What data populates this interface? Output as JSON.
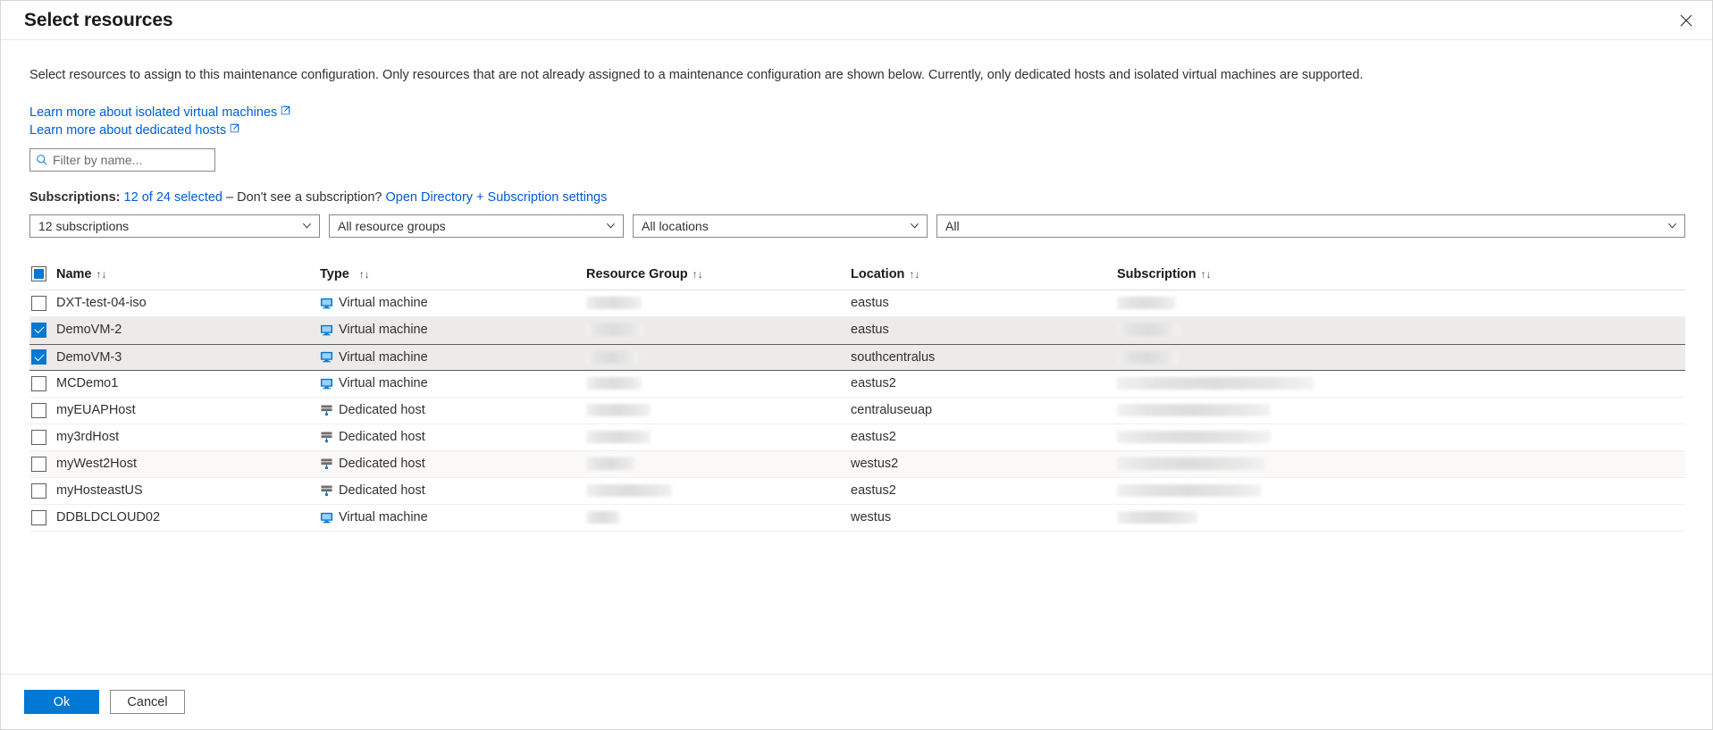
{
  "header": {
    "title": "Select resources",
    "close_label": "✕"
  },
  "description": "Select resources to assign to this maintenance configuration. Only resources that are not already assigned to a maintenance configuration are shown below. Currently, only dedicated hosts and isolated virtual machines are supported.",
  "links": [
    {
      "label": "Learn more about isolated virtual machines"
    },
    {
      "label": "Learn more about dedicated hosts"
    }
  ],
  "filter": {
    "placeholder": "Filter by name...",
    "value": ""
  },
  "subscriptions_line": {
    "label": "Subscriptions:",
    "selected_link": "12 of 24 selected",
    "separator": "– Don't see a subscription?",
    "settings_link": "Open Directory + Subscription settings"
  },
  "dropdowns": [
    {
      "name": "subscription-filter",
      "value": "12 subscriptions"
    },
    {
      "name": "resource-group-filter",
      "value": "All resource groups"
    },
    {
      "name": "location-filter",
      "value": "All locations"
    },
    {
      "name": "type-filter",
      "value": "All"
    }
  ],
  "table": {
    "columns": [
      {
        "key": "name",
        "label": "Name",
        "sort": "↑↓"
      },
      {
        "key": "type",
        "label": "Type",
        "sort": "↑↓"
      },
      {
        "key": "resource_group",
        "label": "Resource Group",
        "sort": "↑↓"
      },
      {
        "key": "location",
        "label": "Location",
        "sort": "↑↓"
      },
      {
        "key": "subscription",
        "label": "Subscription",
        "sort": "↑↓"
      }
    ],
    "header_checkbox_state": "indeterminate",
    "rows": [
      {
        "name": "DXT-test-04-iso",
        "type": "Virtual machine",
        "type_icon": "virtual-machine-icon",
        "resource_group": "",
        "rg_width": 62,
        "location": "eastus",
        "subscription": "",
        "sub_width": 66,
        "checked": false,
        "state": "default"
      },
      {
        "name": "DemoVM-2",
        "type": "Virtual machine",
        "type_icon": "virtual-machine-icon",
        "resource_group": "",
        "rg_width": 64,
        "location": "eastus",
        "subscription": "",
        "sub_width": 70,
        "checked": true,
        "state": "selected"
      },
      {
        "name": "DemoVM-3",
        "type": "Virtual machine",
        "type_icon": "virtual-machine-icon",
        "resource_group": "",
        "rg_width": 58,
        "location": "southcentralus",
        "subscription": "",
        "sub_width": 68,
        "checked": true,
        "state": "focused"
      },
      {
        "name": "MCDemo1",
        "type": "Virtual machine",
        "type_icon": "virtual-machine-icon",
        "resource_group": "",
        "rg_width": 62,
        "location": "eastus2",
        "subscription": "",
        "sub_width": 220,
        "checked": false,
        "state": "default"
      },
      {
        "name": "myEUAPHost",
        "type": "Dedicated host",
        "type_icon": "dedicated-host-icon",
        "resource_group": "",
        "rg_width": 72,
        "location": "centraluseuap",
        "subscription": "",
        "sub_width": 172,
        "checked": false,
        "state": "default"
      },
      {
        "name": "my3rdHost",
        "type": "Dedicated host",
        "type_icon": "dedicated-host-icon",
        "resource_group": "",
        "rg_width": 72,
        "location": "eastus2",
        "subscription": "",
        "sub_width": 172,
        "checked": false,
        "state": "default"
      },
      {
        "name": "myWest2Host",
        "type": "Dedicated host",
        "type_icon": "dedicated-host-icon",
        "resource_group": "",
        "rg_width": 55,
        "location": "westus2",
        "subscription": "",
        "sub_width": 166,
        "checked": false,
        "state": "alt"
      },
      {
        "name": "myHosteastUS",
        "type": "Dedicated host",
        "type_icon": "dedicated-host-icon",
        "resource_group": "",
        "rg_width": 96,
        "location": "eastus2",
        "subscription": "",
        "sub_width": 162,
        "checked": false,
        "state": "default"
      },
      {
        "name": "DDBLDCLOUD02",
        "type": "Virtual machine",
        "type_icon": "virtual-machine-icon",
        "resource_group": "",
        "rg_width": 38,
        "location": "westus",
        "subscription": "",
        "sub_width": 90,
        "checked": false,
        "state": "default"
      }
    ]
  },
  "footer": {
    "ok_label": "Ok",
    "cancel_label": "Cancel"
  },
  "colors": {
    "accent": "#0078d4",
    "link": "#015cda",
    "selected_row": "#edebe9",
    "focus_border": "#605e5c"
  }
}
